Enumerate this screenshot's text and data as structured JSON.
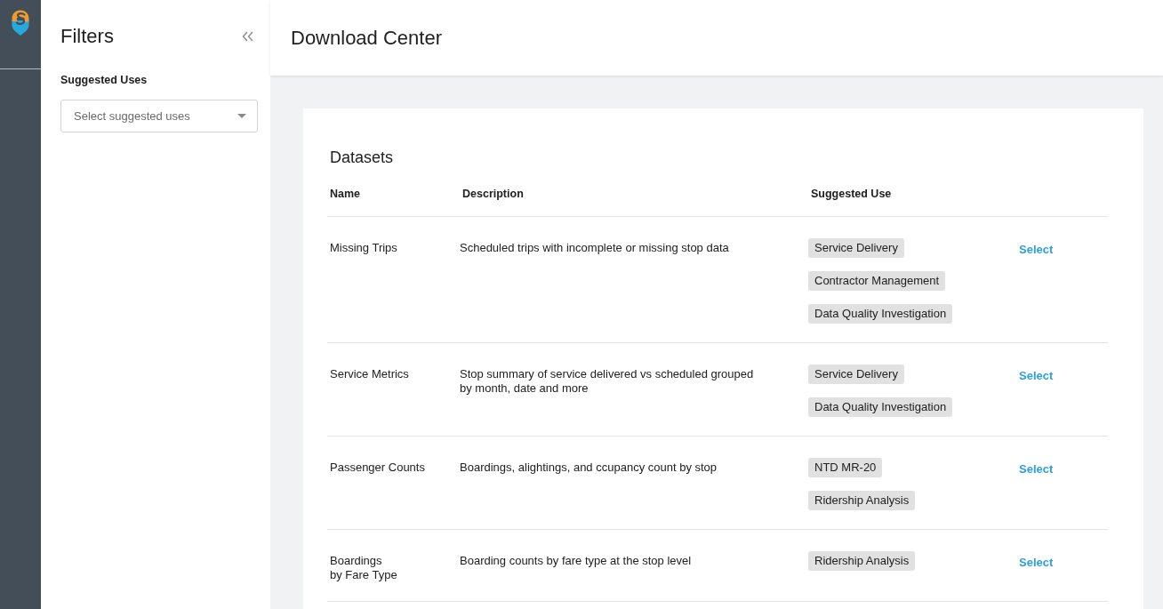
{
  "filters": {
    "title": "Filters",
    "sections": [
      {
        "label": "Suggested Uses",
        "placeholder": "Select suggested uses"
      }
    ]
  },
  "header": {
    "title": "Download Center"
  },
  "datasets": {
    "title": "Datasets",
    "columns": [
      "Name",
      "Description",
      "Suggested Use"
    ],
    "rows": [
      {
        "name": "Missing Trips",
        "description": "Scheduled trips with incomplete or missing stop data",
        "suggested_uses": [
          "Service Delivery",
          "Contractor Management",
          "Data Quality Investigation"
        ],
        "action": "Select"
      },
      {
        "name": "Service Metrics",
        "description": "Stop summary of service delivered vs scheduled grouped\nby month, date and more",
        "suggested_uses": [
          "Service Delivery",
          "Data Quality Investigation"
        ],
        "action": "Select"
      },
      {
        "name": "Passenger Counts",
        "description": "Boardings, alightings, and ccupancy count by stop",
        "suggested_uses": [
          "NTD MR-20",
          "Ridership Analysis"
        ],
        "action": "Select"
      },
      {
        "name": "Boardings\nby Fare Type",
        "description": "Boarding counts by fare type at the stop level",
        "suggested_uses": [
          "Ridership Analysis"
        ],
        "action": "Select"
      }
    ]
  }
}
